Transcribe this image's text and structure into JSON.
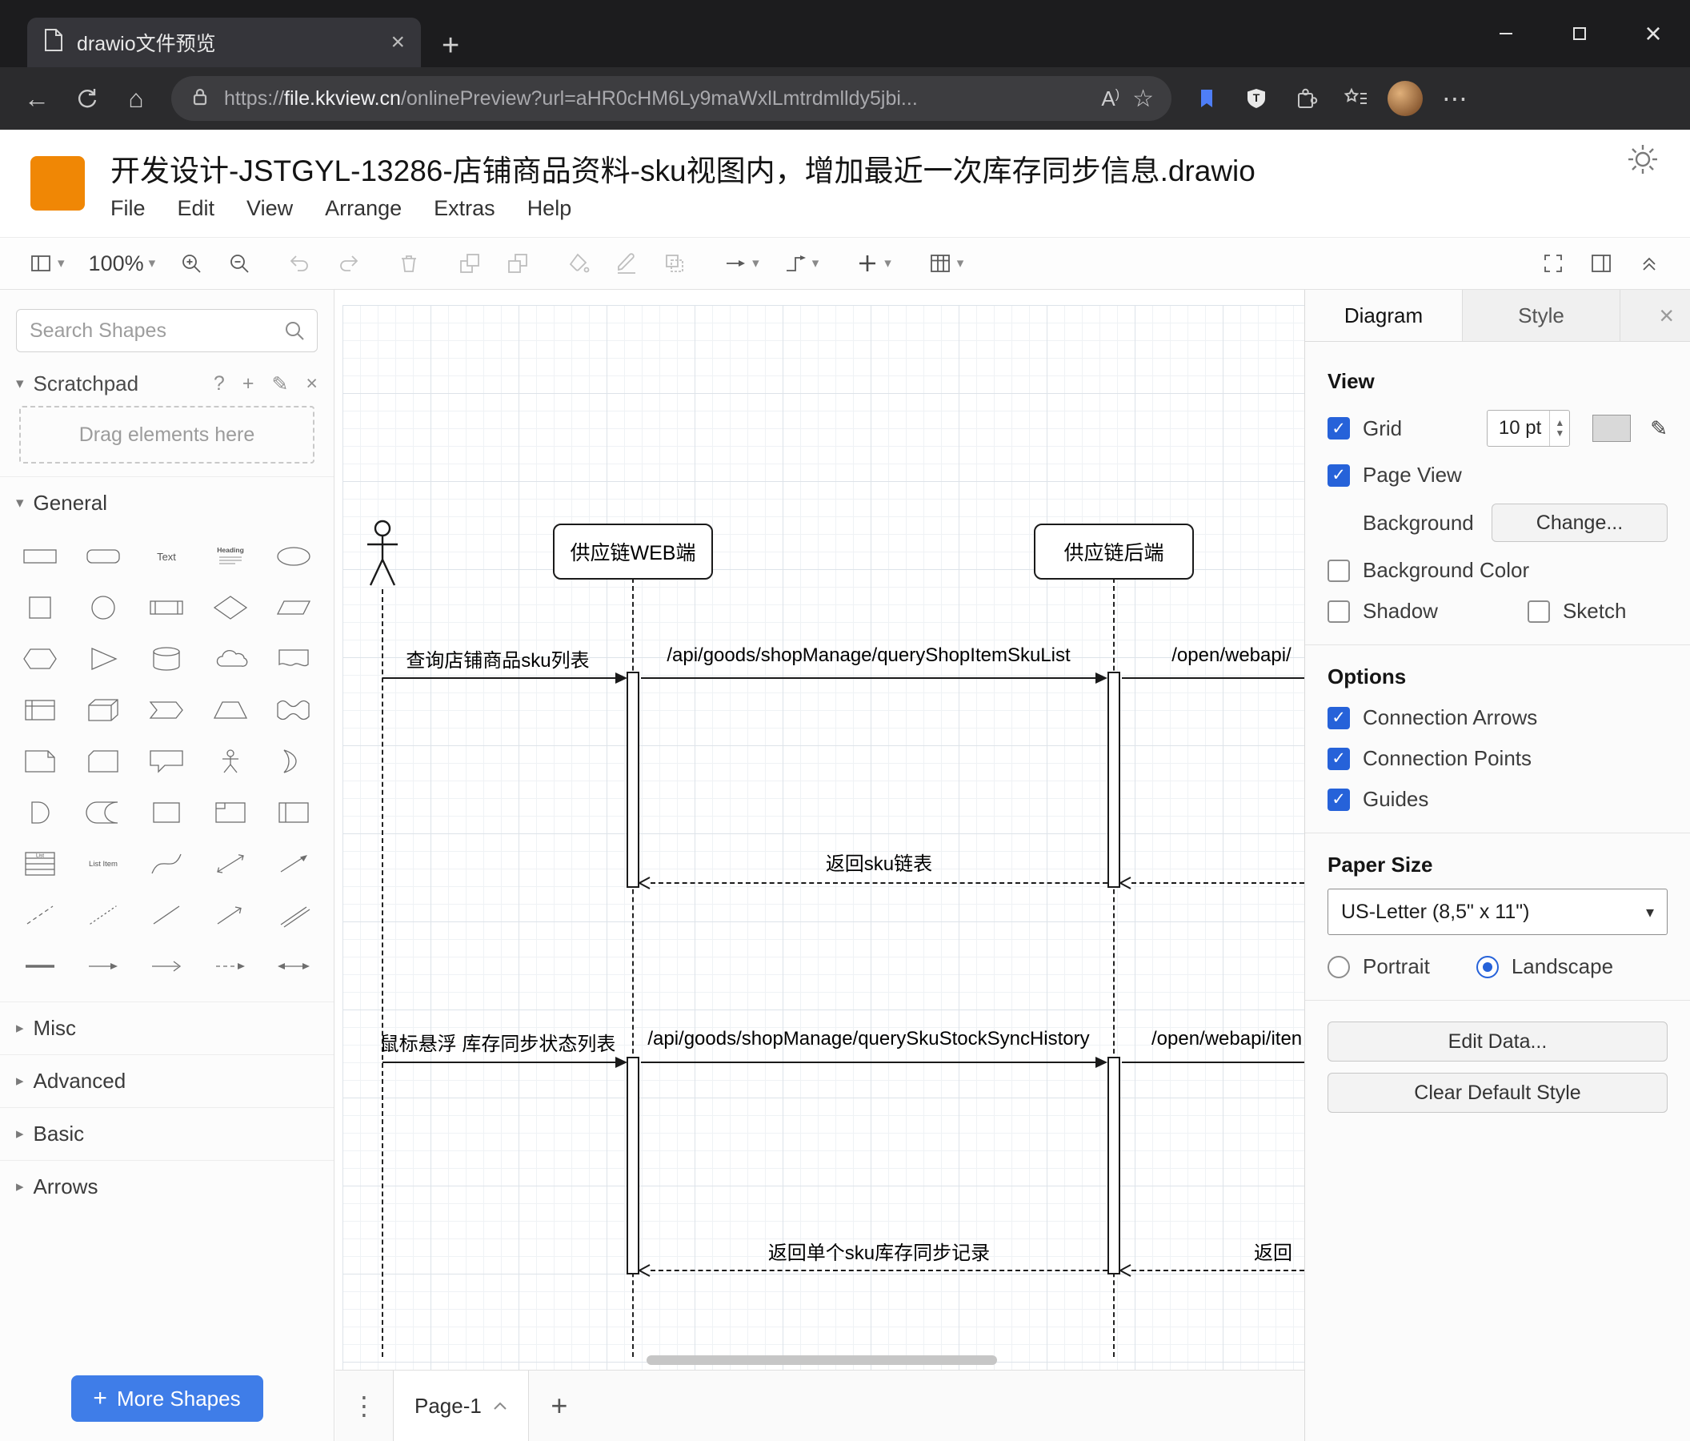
{
  "colors": {
    "brand_orange": "#F08705",
    "primary_button_blue": "#3F7DE8",
    "checkbox_blue": "#2662D9"
  },
  "browser": {
    "tab_title": "drawio文件预览",
    "url_scheme": "https://",
    "url_domain": "file.kkview.cn",
    "url_path": "/onlinePreview?url=aHR0cHM6Ly9maWxlLmtrdmlldy5jbi...",
    "icons": [
      "document",
      "tab-close",
      "new-tab",
      "minimize",
      "maximize",
      "close",
      "back",
      "refresh",
      "home",
      "lock",
      "read-aloud",
      "favorite-star",
      "collections",
      "shield",
      "extensions",
      "favorites-bar",
      "avatar",
      "more"
    ]
  },
  "app": {
    "title": "开发设计-JSTGYL-13286-店铺商品资料-sku视图内，增加最近一次库存同步信息.drawio",
    "menus": [
      "File",
      "Edit",
      "View",
      "Arrange",
      "Extras",
      "Help"
    ],
    "zoom_level": "100%",
    "toolbar_icons": [
      "page-view",
      "zoom-in",
      "zoom-out",
      "undo",
      "redo",
      "delete",
      "to-front",
      "to-back",
      "fill-color",
      "line-color",
      "shadow",
      "connection",
      "waypoints",
      "insert",
      "table",
      "fullscreen",
      "format-panel",
      "collapse"
    ]
  },
  "sidebar": {
    "search_placeholder": "Search Shapes",
    "scratchpad": {
      "title": "Scratchpad",
      "hint": "Drag elements here"
    },
    "sections": [
      "General",
      "Misc",
      "Advanced",
      "Basic",
      "Arrows"
    ],
    "more_shapes_label": "More Shapes",
    "shape_preview": {
      "text": "Text",
      "heading": "Heading",
      "list": "List",
      "list_item": "List Item"
    },
    "shape_names": [
      "rectangle",
      "rounded-rectangle",
      "text",
      "heading",
      "ellipse",
      "square",
      "circle",
      "process",
      "diamond",
      "parallelogram",
      "hexagon",
      "triangle",
      "cylinder",
      "cloud",
      "document",
      "internal-storage",
      "cube",
      "step",
      "trapezoid",
      "tape",
      "note",
      "card",
      "callout",
      "actor",
      "or",
      "and",
      "data-storage",
      "container",
      "frame",
      "vertical-container",
      "list",
      "list-item",
      "curve",
      "bidirectional-arrow",
      "arrow",
      "dashed-line",
      "dotted-line",
      "line",
      "directional-arrow",
      "link",
      "horizontal-line",
      "horizontal-arrow",
      "open-arrow",
      "dashed-arrow",
      "bidirectional-horizontal-arrow"
    ]
  },
  "canvas": {
    "lifelines": [
      "供应链WEB端",
      "供应链后端"
    ],
    "messages": {
      "query_sku_list": "查询店铺商品sku列表",
      "api_query_shop_item_sku_list": "/api/goods/shopManage/queryShopItemSkuList",
      "open_webapi_1": "/open/webapi/",
      "return_sku_list": "返回sku链表",
      "hover_stock_sync": "鼠标悬浮 库存同步状态列表",
      "api_query_sku_stock_sync_history": "/api/goods/shopManage/querySkuStockSyncHistory",
      "open_webapi_2": "/open/webapi/iten",
      "return_single_sku": "返回单个sku库存同步记录",
      "return_partial": "返回"
    },
    "page_tab": "Page-1"
  },
  "format_panel": {
    "tabs": [
      "Diagram",
      "Style"
    ],
    "view": {
      "heading": "View",
      "grid_label": "Grid",
      "grid_size": "10 pt",
      "page_view_label": "Page View",
      "background_label": "Background",
      "change_button": "Change...",
      "background_color_label": "Background Color",
      "shadow_label": "Shadow",
      "sketch_label": "Sketch"
    },
    "options": {
      "heading": "Options",
      "connection_arrows": "Connection Arrows",
      "connection_points": "Connection Points",
      "guides": "Guides"
    },
    "paper": {
      "heading": "Paper Size",
      "size_value": "US-Letter (8,5\" x 11\")",
      "portrait": "Portrait",
      "landscape": "Landscape"
    },
    "actions": {
      "edit_data": "Edit Data...",
      "clear_default_style": "Clear Default Style"
    }
  }
}
